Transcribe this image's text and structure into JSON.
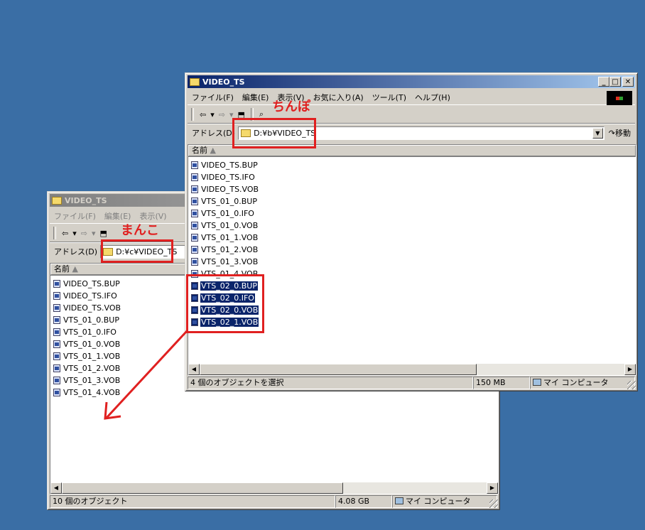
{
  "left_window": {
    "title": "VIDEO_TS",
    "menu": [
      "ファイル(F)",
      "編集(E)",
      "表示(V)"
    ],
    "toolbar": {
      "back": "⇦",
      "forward": "⇨"
    },
    "address_label": "アドレス(D)",
    "address_value": "D:¥c¥VIDEO_TS",
    "column_name": "名前",
    "files": [
      "VIDEO_TS.BUP",
      "VIDEO_TS.IFO",
      "VIDEO_TS.VOB",
      "VTS_01_0.BUP",
      "VTS_01_0.IFO",
      "VTS_01_0.VOB",
      "VTS_01_1.VOB",
      "VTS_01_2.VOB",
      "VTS_01_3.VOB",
      "VTS_01_4.VOB"
    ],
    "status_count": "10 個のオブジェクト",
    "status_size": "4.08 GB",
    "status_location": "マイ コンピュータ",
    "annotation": "まんこ"
  },
  "right_window": {
    "title": "VIDEO_TS",
    "menu": [
      "ファイル(F)",
      "編集(E)",
      "表示(V)",
      "お気に入り(A)",
      "ツール(T)",
      "ヘルプ(H)"
    ],
    "toolbar": {
      "back": "⇦",
      "forward": "⇨"
    },
    "address_label": "アドレス(D)",
    "address_value": "D:¥b¥VIDEO_TS",
    "go_label": "移動",
    "column_name": "名前",
    "files": [
      {
        "name": "VIDEO_TS.BUP",
        "selected": false
      },
      {
        "name": "VIDEO_TS.IFO",
        "selected": false
      },
      {
        "name": "VIDEO_TS.VOB",
        "selected": false
      },
      {
        "name": "VTS_01_0.BUP",
        "selected": false
      },
      {
        "name": "VTS_01_0.IFO",
        "selected": false
      },
      {
        "name": "VTS_01_0.VOB",
        "selected": false
      },
      {
        "name": "VTS_01_1.VOB",
        "selected": false
      },
      {
        "name": "VTS_01_2.VOB",
        "selected": false
      },
      {
        "name": "VTS_01_3.VOB",
        "selected": false
      },
      {
        "name": "VTS_01_4.VOB",
        "selected": false
      },
      {
        "name": "VTS_02_0.BUP",
        "selected": true
      },
      {
        "name": "VTS_02_0.IFO",
        "selected": true
      },
      {
        "name": "VTS_02_0.VOB",
        "selected": true
      },
      {
        "name": "VTS_02_1.VOB",
        "selected": true
      }
    ],
    "status_count": "4 個のオブジェクトを選択",
    "status_size": "150 MB",
    "status_location": "マイ コンピュータ",
    "annotation": "ちんぽ"
  },
  "colors": {
    "desktop": "#3a6ea5",
    "annotation": "#e02020",
    "selection": "#0a246a"
  }
}
